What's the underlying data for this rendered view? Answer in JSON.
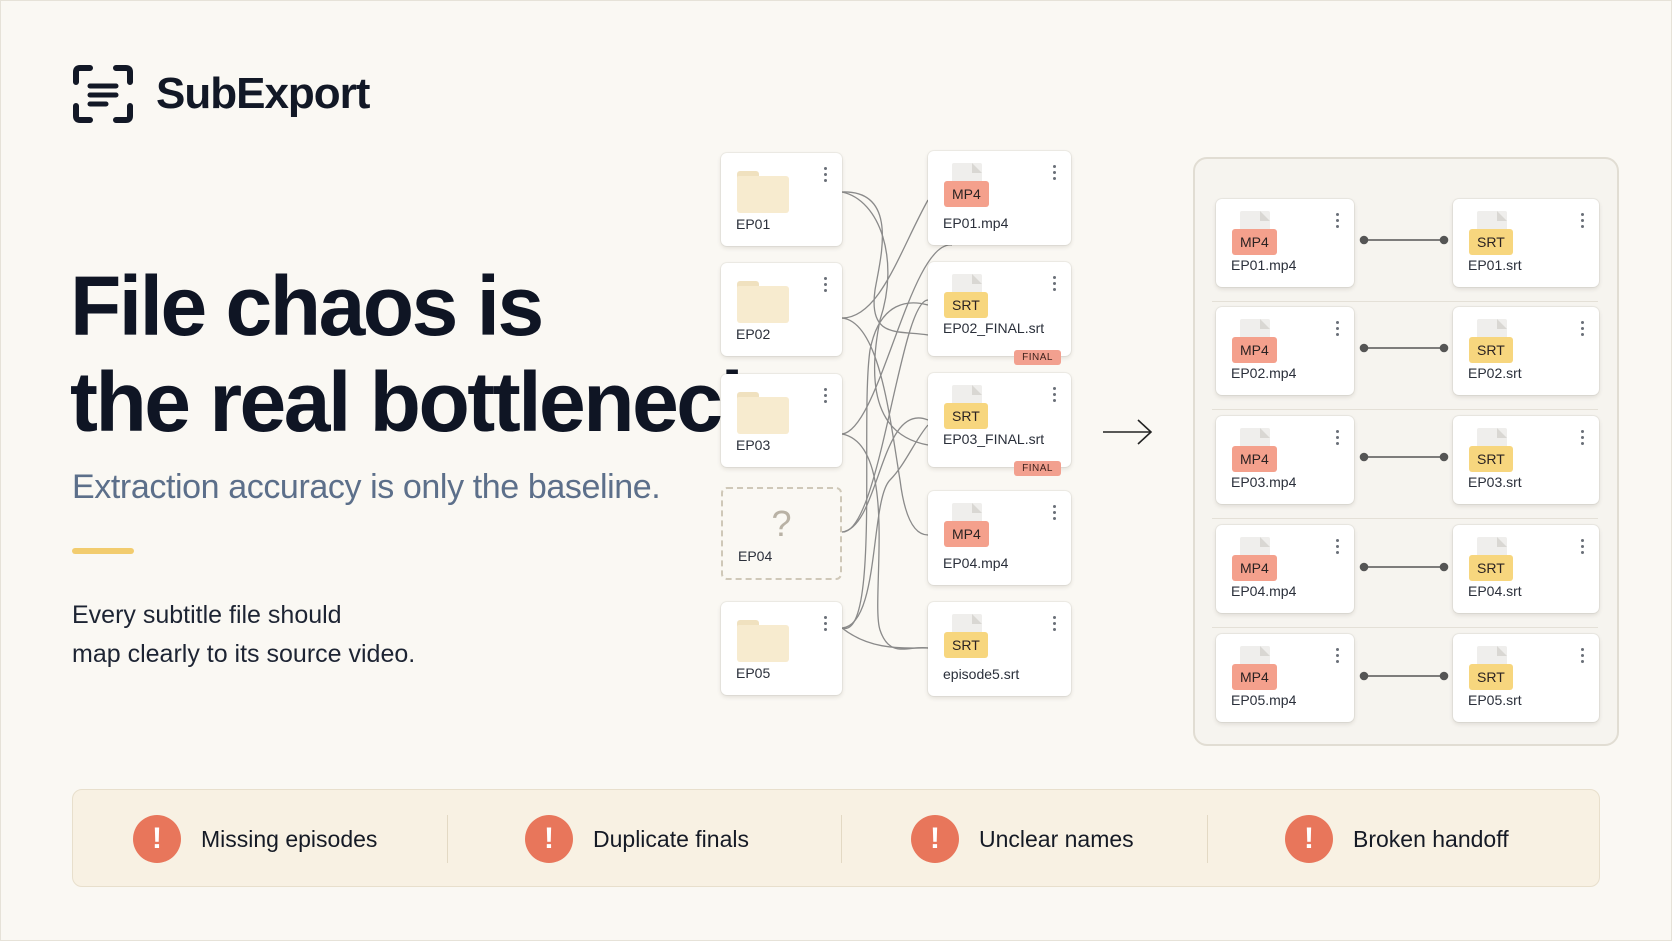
{
  "brand": {
    "name": "SubExport",
    "logo_icon": "scan-brackets-icon"
  },
  "hero": {
    "headline_line1": "File chaos is",
    "headline_line2": "the real bottleneck",
    "subhead": "Extraction accuracy is only the baseline.",
    "body_line1": "Every subtitle file should",
    "body_line2": "map clearly to its source video."
  },
  "chaos": {
    "folders": [
      {
        "label": "EP01"
      },
      {
        "label": "EP02"
      },
      {
        "label": "EP03"
      },
      {
        "label": "EP04",
        "missing": true,
        "mark": "?"
      },
      {
        "label": "EP05"
      }
    ],
    "files": [
      {
        "type": "MP4",
        "label": "EP01.mp4"
      },
      {
        "type": "SRT",
        "label": "EP02_FINAL.srt",
        "tag": "FINAL"
      },
      {
        "type": "SRT",
        "label": "EP03_FINAL.srt",
        "tag": "FINAL"
      },
      {
        "type": "MP4",
        "label": "EP04.mp4"
      },
      {
        "type": "SRT",
        "label": "episode5.srt"
      }
    ]
  },
  "mapped": [
    {
      "video_type": "MP4",
      "video": "EP01.mp4",
      "sub_type": "SRT",
      "sub": "EP01.srt"
    },
    {
      "video_type": "MP4",
      "video": "EP02.mp4",
      "sub_type": "SRT",
      "sub": "EP02.srt"
    },
    {
      "video_type": "MP4",
      "video": "EP03.mp4",
      "sub_type": "SRT",
      "sub": "EP03.srt"
    },
    {
      "video_type": "MP4",
      "video": "EP04.mp4",
      "sub_type": "SRT",
      "sub": "EP04.srt"
    },
    {
      "video_type": "MP4",
      "video": "EP05.mp4",
      "sub_type": "SRT",
      "sub": "EP05.srt"
    }
  ],
  "issues": [
    {
      "icon": "alert-icon",
      "label": "Missing episodes"
    },
    {
      "icon": "alert-icon",
      "label": "Duplicate finals"
    },
    {
      "icon": "alert-icon",
      "label": "Unclear names"
    },
    {
      "icon": "alert-icon",
      "label": "Broken handoff"
    }
  ],
  "colors": {
    "background": "#faf8f3",
    "mp4_badge": "#f4a08c",
    "srt_badge": "#f7d67e",
    "alert": "#e8765b",
    "accent": "#f2cc6e",
    "subhead": "#5c6f8a"
  }
}
